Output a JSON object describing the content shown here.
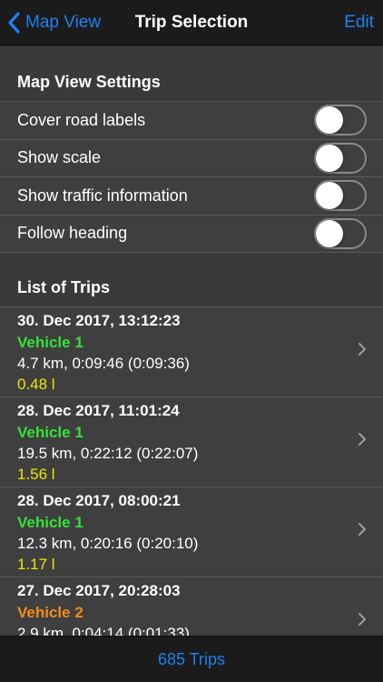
{
  "navbar": {
    "back_label": "Map View",
    "title": "Trip Selection",
    "edit_label": "Edit"
  },
  "settings": {
    "header": "Map View Settings",
    "items": [
      {
        "label": "Cover road labels",
        "enabled": false
      },
      {
        "label": "Show scale",
        "enabled": false
      },
      {
        "label": "Show traffic information",
        "enabled": false
      },
      {
        "label": "Follow heading",
        "enabled": false
      }
    ]
  },
  "trips": {
    "header": "List of Trips",
    "items": [
      {
        "date": "30. Dec 2017, 13:12:23",
        "vehicle": "Vehicle 1",
        "vehicle_color": "#36e23a",
        "stats": "4.7 km, 0:09:46 (0:09:36)",
        "fuel": "0.48 l"
      },
      {
        "date": "28. Dec 2017, 11:01:24",
        "vehicle": "Vehicle 1",
        "vehicle_color": "#36e23a",
        "stats": "19.5 km, 0:22:12 (0:22:07)",
        "fuel": "1.56 l"
      },
      {
        "date": "28. Dec 2017, 08:00:21",
        "vehicle": "Vehicle 1",
        "vehicle_color": "#36e23a",
        "stats": "12.3 km, 0:20:16 (0:20:10)",
        "fuel": "1.17 l"
      },
      {
        "date": "27. Dec 2017, 20:28:03",
        "vehicle": "Vehicle 2",
        "vehicle_color": "#f08c1e",
        "stats": "2.9 km, 0:04:14 (0:01:33)",
        "fuel": ""
      }
    ]
  },
  "tabbar": {
    "count_label": "685 Trips"
  },
  "colors": {
    "accent": "#1e82f0",
    "fuel": "#f0e600"
  },
  "icons": {
    "back": "chevron-left-icon",
    "disclosure": "chevron-right-icon"
  }
}
